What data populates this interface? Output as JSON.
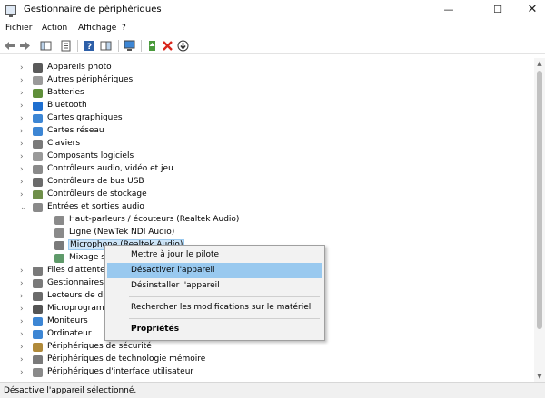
{
  "window": {
    "title": "Gestionnaire de périphériques",
    "minimize": "—",
    "maximize": "☐",
    "close": "✕"
  },
  "menu": [
    "Fichier",
    "Action",
    "Affichage",
    "?"
  ],
  "toolbar": [
    "back-arrow-icon",
    "forward-arrow-icon",
    "show-hide-tree-icon",
    "properties-icon",
    "help-icon",
    "action-pane-icon",
    "monitor-scan-icon",
    "update-driver-icon",
    "uninstall-icon",
    "enable-disable-icon"
  ],
  "tree": [
    {
      "label": "Appareils photo",
      "icon": "camera-icon",
      "expanded": false
    },
    {
      "label": "Autres périphériques",
      "icon": "unknown-device-icon",
      "expanded": false
    },
    {
      "label": "Batteries",
      "icon": "battery-icon",
      "expanded": false
    },
    {
      "label": "Bluetooth",
      "icon": "bluetooth-icon",
      "expanded": false
    },
    {
      "label": "Cartes graphiques",
      "icon": "display-adapter-icon",
      "expanded": false
    },
    {
      "label": "Cartes réseau",
      "icon": "network-icon",
      "expanded": false
    },
    {
      "label": "Claviers",
      "icon": "keyboard-icon",
      "expanded": false
    },
    {
      "label": "Composants logiciels",
      "icon": "software-component-icon",
      "expanded": false
    },
    {
      "label": "Contrôleurs audio, vidéo et jeu",
      "icon": "speaker-icon",
      "expanded": false
    },
    {
      "label": "Contrôleurs de bus USB",
      "icon": "usb-icon",
      "expanded": false
    },
    {
      "label": "Contrôleurs de stockage",
      "icon": "storage-icon",
      "expanded": false
    },
    {
      "label": "Entrées et sorties audio",
      "icon": "speaker-icon",
      "expanded": true
    },
    {
      "label": "Haut-parleurs / écouteurs (Realtek Audio)",
      "icon": "speaker-icon",
      "child": true
    },
    {
      "label": "Ligne (NewTek NDI Audio)",
      "icon": "speaker-icon",
      "child": true
    },
    {
      "label": "Microphone (Realtek Audio)",
      "icon": "microphone-icon",
      "child": true,
      "selected": true
    },
    {
      "label": "Mixage stéréo (Realtek Audio)",
      "icon": "mixer-icon",
      "child": true
    },
    {
      "label": "Files d'attente à l'impression",
      "icon": "printer-icon",
      "expanded": false
    },
    {
      "label": "Gestionnaires de connexion",
      "icon": "connection-icon",
      "expanded": false
    },
    {
      "label": "Lecteurs de disque",
      "icon": "disk-icon",
      "expanded": false
    },
    {
      "label": "Microprogrammes",
      "icon": "firmware-icon",
      "expanded": false
    },
    {
      "label": "Moniteurs",
      "icon": "monitor-icon",
      "expanded": false
    },
    {
      "label": "Ordinateur",
      "icon": "computer-icon",
      "expanded": false
    },
    {
      "label": "Périphériques de sécurité",
      "icon": "security-device-icon",
      "expanded": false
    },
    {
      "label": "Périphériques de technologie mémoire",
      "icon": "memory-device-icon",
      "expanded": false
    },
    {
      "label": "Périphériques d'interface utilisateur",
      "icon": "hid-icon",
      "expanded": false
    }
  ],
  "context_menu": {
    "items": [
      {
        "label": "Mettre à jour le pilote"
      },
      {
        "label": "Désactiver l'appareil",
        "hover": true
      },
      {
        "label": "Désinstaller l'appareil"
      },
      {
        "separator": true
      },
      {
        "label": "Rechercher les modifications sur le matériel"
      },
      {
        "separator": true
      },
      {
        "label": "Propriétés",
        "bold": true
      }
    ]
  },
  "status": "Désactive l'appareil sélectionné.",
  "colors": {
    "selection": "#cde4f7",
    "menu_hover": "#99c9ef",
    "menu_bg": "#f2f2f2"
  }
}
